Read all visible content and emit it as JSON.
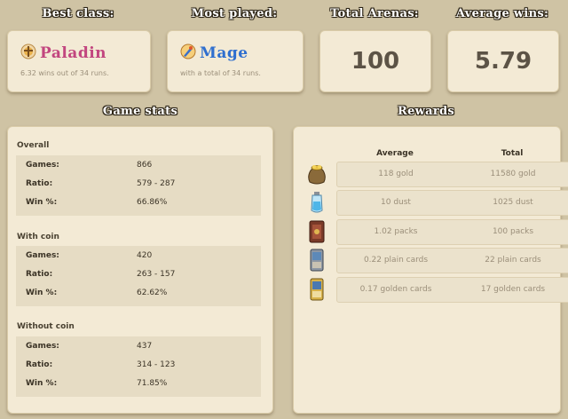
{
  "headers": {
    "best_class": "Best class:",
    "most_played": "Most played:",
    "total_arenas": "Total Arenas:",
    "average_wins": "Average wins:",
    "game_stats": "Game stats",
    "rewards": "Rewards"
  },
  "best_class": {
    "name": "Paladin",
    "subtitle": "6.32 wins out of 34 runs.",
    "icon": "paladin-class-icon",
    "color": "#c2467f"
  },
  "most_played": {
    "name": "Mage",
    "subtitle": "with a total of 34 runs.",
    "icon": "mage-class-icon",
    "color": "#2f6fcf"
  },
  "total_arenas": "100",
  "average_wins": "5.79",
  "game_stats": {
    "sections": [
      {
        "title": "Overall",
        "rows": [
          {
            "label": "Games:",
            "value": "866"
          },
          {
            "label": "Ratio:",
            "value": "579 - 287"
          },
          {
            "label": "Win %:",
            "value": "66.86%"
          }
        ]
      },
      {
        "title": "With coin",
        "rows": [
          {
            "label": "Games:",
            "value": "420"
          },
          {
            "label": "Ratio:",
            "value": "263 - 157"
          },
          {
            "label": "Win %:",
            "value": "62.62%"
          }
        ]
      },
      {
        "title": "Without coin",
        "rows": [
          {
            "label": "Games:",
            "value": "437"
          },
          {
            "label": "Ratio:",
            "value": "314 - 123"
          },
          {
            "label": "Win %:",
            "value": "71.85%"
          }
        ]
      }
    ]
  },
  "rewards": {
    "columns": {
      "average": "Average",
      "total": "Total"
    },
    "rows": [
      {
        "icon": "gold-bag-icon",
        "average": "118 gold",
        "total": "11580 gold"
      },
      {
        "icon": "arcane-dust-icon",
        "average": "10 dust",
        "total": "1025 dust"
      },
      {
        "icon": "card-pack-icon",
        "average": "1.02 packs",
        "total": "100 packs"
      },
      {
        "icon": "plain-card-icon",
        "average": "0.22 plain cards",
        "total": "22 plain cards"
      },
      {
        "icon": "golden-card-icon",
        "average": "0.17 golden cards",
        "total": "17 golden cards"
      }
    ]
  }
}
